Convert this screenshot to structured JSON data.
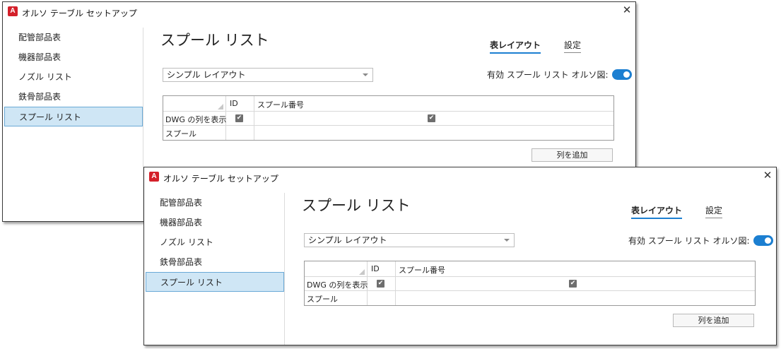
{
  "window": {
    "title": "オルソ テーブル セットアップ",
    "app_icon_letter": "A",
    "close_glyph": "✕"
  },
  "sidebar": {
    "items": [
      {
        "label": "配管部品表"
      },
      {
        "label": "機器部品表"
      },
      {
        "label": "ノズル リスト"
      },
      {
        "label": "鉄骨部品表"
      },
      {
        "label": "スプール リスト",
        "selected": true
      }
    ]
  },
  "main": {
    "heading": "スプール リスト",
    "tabs": [
      {
        "label": "表レイアウト",
        "active": true
      },
      {
        "label": "設定",
        "active": false
      }
    ],
    "layout_select": {
      "value": "シンプル レイアウト"
    },
    "enable_label": "有効 スプール リスト オルソ図:",
    "toggle_on": true,
    "grid": {
      "columns": [
        "ID",
        "スプール番号"
      ],
      "rows": [
        {
          "label": "DWG の列を表示",
          "checks": [
            true,
            true
          ]
        },
        {
          "label": "スプール",
          "checks": [
            false,
            false
          ]
        }
      ]
    },
    "add_column_button": "列を追加"
  },
  "colors": {
    "accent": "#1c7fd1",
    "selection_bg": "#cfe6f5",
    "app_icon_red": "#d4202a"
  }
}
